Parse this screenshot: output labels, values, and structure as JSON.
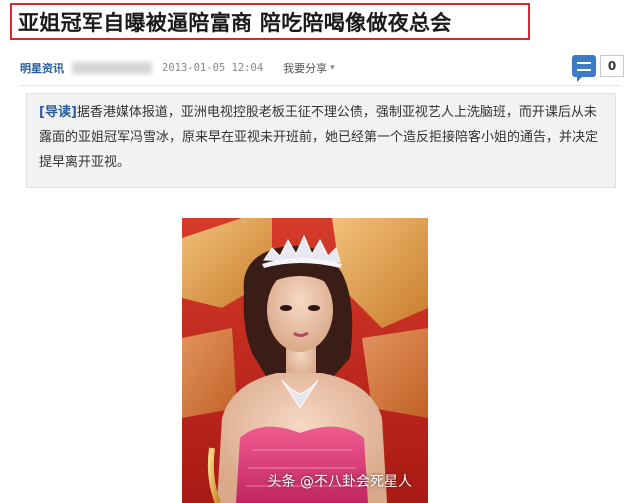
{
  "headline": {
    "title": "亚姐冠军自曝被逼陪富商 陪吃陪喝像做夜总会"
  },
  "meta": {
    "source": "明星资讯",
    "date": "2013-01-05 12:04",
    "share_label": "我要分享",
    "comment_count": "0"
  },
  "lead": {
    "tag": "[导读]",
    "text": "据香港媒体报道，亚洲电视控股老板王征不理公债，强制亚视艺人上洗脑班，而开课后从未露面的亚姐冠军冯雪冰，原来早在亚视未开班前，她已经第一个造反拒接陪客小姐的通告，并决定提早离开亚视。"
  },
  "watermark": "头条 @不八卦会死星人",
  "colors": {
    "headline_border": "#d9272e",
    "link_blue": "#2b5e9e",
    "photo_background": "#c8241c",
    "gown_pink": "#e0437c"
  }
}
